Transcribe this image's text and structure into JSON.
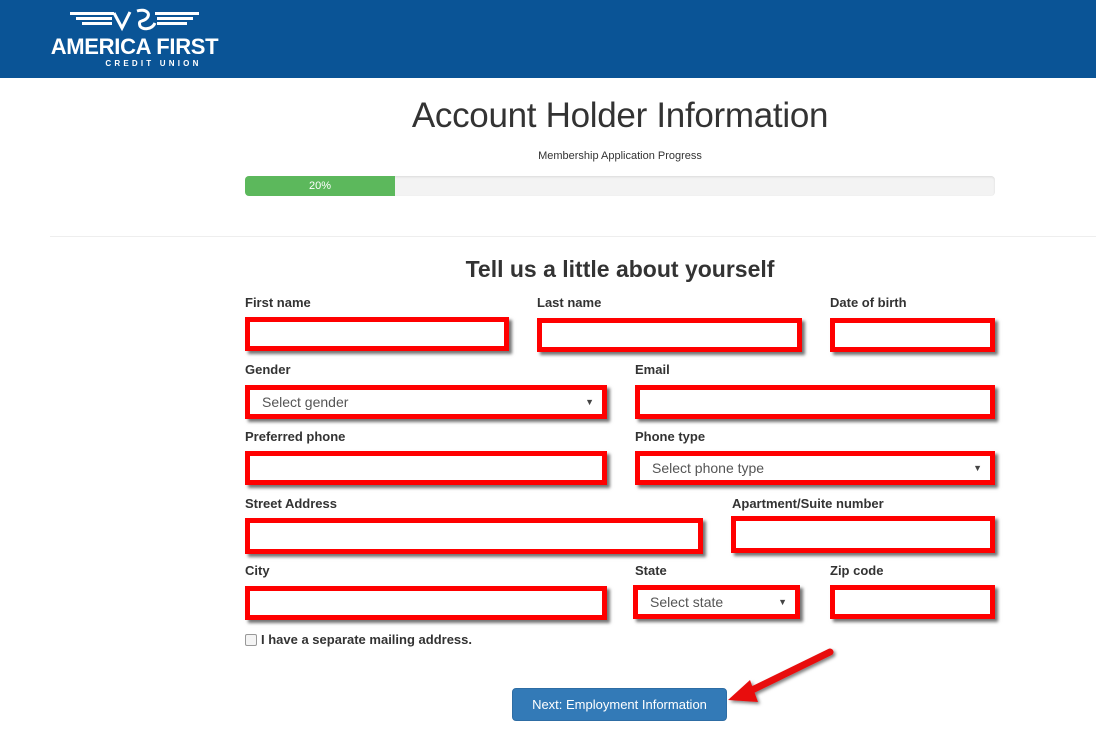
{
  "header": {
    "brand_name": "AMERICA FIRST",
    "brand_subtitle": "CREDIT UNION",
    "background_color": "#0a5496"
  },
  "page": {
    "title": "Account Holder Information",
    "progress_label": "Membership Application Progress",
    "progress_percent": 20,
    "progress_text": "20%",
    "progress_color": "#5cb85c"
  },
  "form": {
    "section_title": "Tell us a little about yourself",
    "fields": {
      "first_name": {
        "label": "First name",
        "value": ""
      },
      "last_name": {
        "label": "Last name",
        "value": ""
      },
      "date_of_birth": {
        "label": "Date of birth",
        "value": ""
      },
      "gender": {
        "label": "Gender",
        "placeholder": "Select gender"
      },
      "email": {
        "label": "Email",
        "value": ""
      },
      "preferred_phone": {
        "label": "Preferred phone",
        "value": ""
      },
      "phone_type": {
        "label": "Phone type",
        "placeholder": "Select phone type"
      },
      "street_address": {
        "label": "Street Address",
        "value": ""
      },
      "apartment": {
        "label": "Apartment/Suite number",
        "value": ""
      },
      "city": {
        "label": "City",
        "value": ""
      },
      "state": {
        "label": "State",
        "placeholder": "Select state"
      },
      "zip_code": {
        "label": "Zip code",
        "value": ""
      }
    },
    "mailing_checkbox": {
      "label": "I have a separate mailing address.",
      "checked": false
    },
    "next_button": {
      "label": "Next: Employment Information",
      "color": "#337ab7"
    },
    "highlight_color": "#ff0000"
  }
}
